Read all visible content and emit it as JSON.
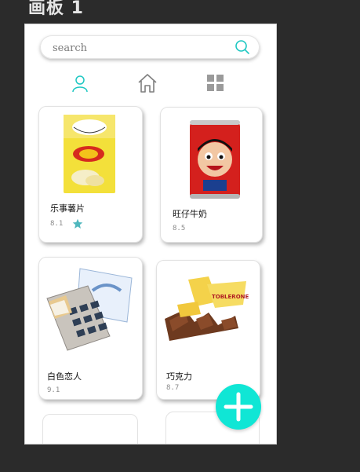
{
  "artboard": {
    "title": "画板 1"
  },
  "search": {
    "placeholder": "search"
  },
  "nav": {
    "tabs": [
      "user",
      "home",
      "grid"
    ]
  },
  "products": [
    {
      "name": "乐事薯片",
      "rating": "8.1",
      "favorite": true
    },
    {
      "name": "旺仔牛奶",
      "rating": "8.5",
      "favorite": false
    },
    {
      "name": "白色恋人",
      "rating": "9.1",
      "favorite": false
    },
    {
      "name": "巧克力",
      "rating": "8.7",
      "favorite": false
    }
  ],
  "colors": {
    "accent": "#1dc7c2",
    "fab": "#10e6d5",
    "star": "#4fb7bd"
  },
  "icons": {
    "search": "search-icon",
    "user": "user-icon",
    "home": "home-icon",
    "grid": "grid-icon",
    "add": "plus-icon",
    "favorite": "star-icon"
  }
}
